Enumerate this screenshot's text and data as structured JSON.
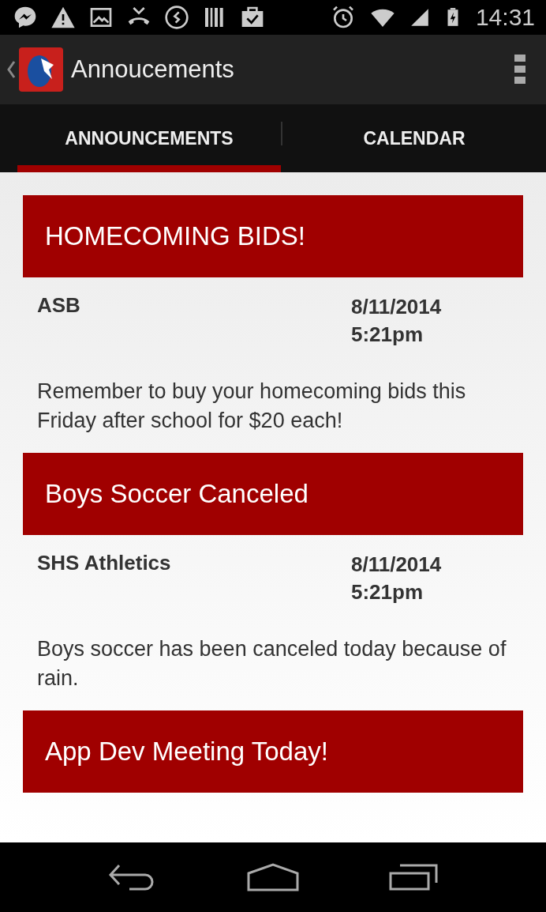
{
  "status_bar": {
    "time": "14:31"
  },
  "app_bar": {
    "title": "Annoucements"
  },
  "tabs": [
    {
      "label": "ANNOUNCEMENTS",
      "selected": true
    },
    {
      "label": "CALENDAR",
      "selected": false
    }
  ],
  "announcements": [
    {
      "title": "HOMECOMING BIDS!",
      "author": "ASB",
      "date": "8/11/2014",
      "time": "5:21pm",
      "body": "Remember to buy your homecoming bids this Friday after school for $20 each!"
    },
    {
      "title": "Boys Soccer Canceled",
      "author": "SHS Athletics",
      "date": "8/11/2014",
      "time": "5:21pm",
      "body": "Boys soccer has been canceled today because of rain."
    },
    {
      "title": "App Dev Meeting Today!"
    }
  ]
}
